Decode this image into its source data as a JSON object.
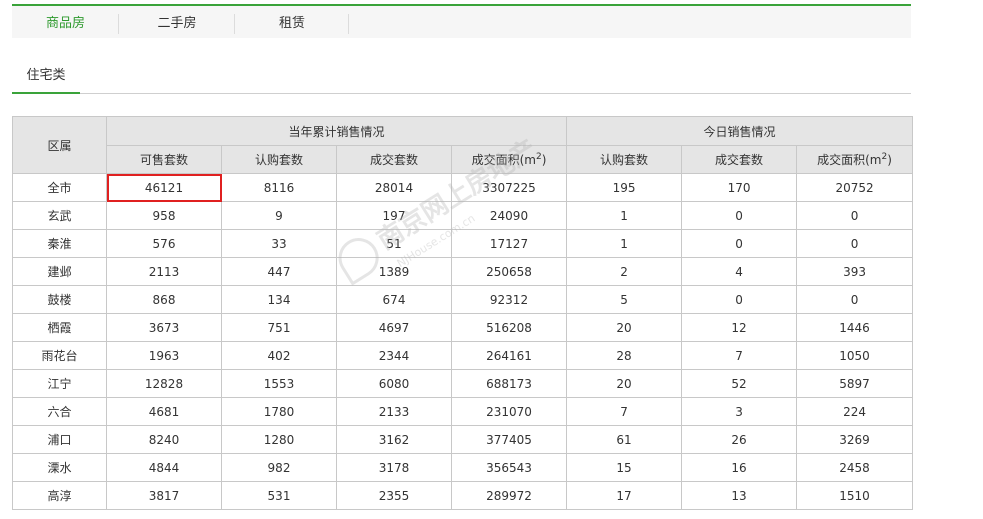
{
  "top_tabs": [
    "商品房",
    "二手房",
    "租赁"
  ],
  "sub_tab": "住宅类",
  "table": {
    "col_district": "区属",
    "group_year": "当年累计销售情况",
    "group_today": "今日销售情况",
    "col_available": "可售套数",
    "col_subscribed": "认购套数",
    "col_deals": "成交套数",
    "col_area_prefix": "成交面积(m",
    "col_area_exp": "2",
    "col_area_suffix": ")",
    "rows": [
      {
        "district": "全市",
        "available": "46121",
        "year_subscribed": "8116",
        "year_deals": "28014",
        "year_area": "3307225",
        "today_subscribed": "195",
        "today_deals": "170",
        "today_area": "20752"
      },
      {
        "district": "玄武",
        "available": "958",
        "year_subscribed": "9",
        "year_deals": "197",
        "year_area": "24090",
        "today_subscribed": "1",
        "today_deals": "0",
        "today_area": "0"
      },
      {
        "district": "秦淮",
        "available": "576",
        "year_subscribed": "33",
        "year_deals": "51",
        "year_area": "17127",
        "today_subscribed": "1",
        "today_deals": "0",
        "today_area": "0"
      },
      {
        "district": "建邺",
        "available": "2113",
        "year_subscribed": "447",
        "year_deals": "1389",
        "year_area": "250658",
        "today_subscribed": "2",
        "today_deals": "4",
        "today_area": "393"
      },
      {
        "district": "鼓楼",
        "available": "868",
        "year_subscribed": "134",
        "year_deals": "674",
        "year_area": "92312",
        "today_subscribed": "5",
        "today_deals": "0",
        "today_area": "0"
      },
      {
        "district": "栖霞",
        "available": "3673",
        "year_subscribed": "751",
        "year_deals": "4697",
        "year_area": "516208",
        "today_subscribed": "20",
        "today_deals": "12",
        "today_area": "1446"
      },
      {
        "district": "雨花台",
        "available": "1963",
        "year_subscribed": "402",
        "year_deals": "2344",
        "year_area": "264161",
        "today_subscribed": "28",
        "today_deals": "7",
        "today_area": "1050"
      },
      {
        "district": "江宁",
        "available": "12828",
        "year_subscribed": "1553",
        "year_deals": "6080",
        "year_area": "688173",
        "today_subscribed": "20",
        "today_deals": "52",
        "today_area": "5897"
      },
      {
        "district": "六合",
        "available": "4681",
        "year_subscribed": "1780",
        "year_deals": "2133",
        "year_area": "231070",
        "today_subscribed": "7",
        "today_deals": "3",
        "today_area": "224"
      },
      {
        "district": "浦口",
        "available": "8240",
        "year_subscribed": "1280",
        "year_deals": "3162",
        "year_area": "377405",
        "today_subscribed": "61",
        "today_deals": "26",
        "today_area": "3269"
      },
      {
        "district": "溧水",
        "available": "4844",
        "year_subscribed": "982",
        "year_deals": "3178",
        "year_area": "356543",
        "today_subscribed": "15",
        "today_deals": "16",
        "today_area": "2458"
      },
      {
        "district": "高淳",
        "available": "3817",
        "year_subscribed": "531",
        "year_deals": "2355",
        "year_area": "289972",
        "today_subscribed": "17",
        "today_deals": "13",
        "today_area": "1510"
      }
    ]
  },
  "watermark": {
    "text": "南京网上房地产",
    "url": "NJHouse.com.cn"
  },
  "colors": {
    "accent": "#3aa33a",
    "highlight": "#e02020",
    "header_bg": "#e5e5e5"
  }
}
